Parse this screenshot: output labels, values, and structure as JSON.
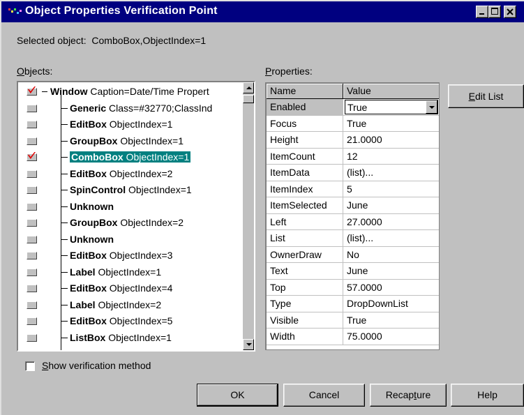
{
  "window": {
    "title": "Object Properties Verification Point",
    "selected_prefix": "Selected object:",
    "selected_value": "ComboBox,ObjectIndex=1"
  },
  "objects": {
    "label_accel": "O",
    "label_rest": "bjects:",
    "items": [
      {
        "name": "Window",
        "desc": "Caption=Date/Time Propert",
        "checked": true,
        "root": true
      },
      {
        "name": "Generic",
        "desc": "Class=#32770;ClassInd",
        "checked": false
      },
      {
        "name": "EditBox",
        "desc": "ObjectIndex=1",
        "checked": false
      },
      {
        "name": "GroupBox",
        "desc": "ObjectIndex=1",
        "checked": false
      },
      {
        "name": "ComboBox",
        "desc": "ObjectIndex=1",
        "checked": true,
        "selected": true
      },
      {
        "name": "EditBox",
        "desc": "ObjectIndex=2",
        "checked": false
      },
      {
        "name": "SpinControl",
        "desc": "ObjectIndex=1",
        "checked": false
      },
      {
        "name": "Unknown",
        "desc": "",
        "checked": false
      },
      {
        "name": "GroupBox",
        "desc": "ObjectIndex=2",
        "checked": false
      },
      {
        "name": "Unknown",
        "desc": "",
        "checked": false
      },
      {
        "name": "EditBox",
        "desc": "ObjectIndex=3",
        "checked": false
      },
      {
        "name": "Label",
        "desc": "ObjectIndex=1",
        "checked": false
      },
      {
        "name": "EditBox",
        "desc": "ObjectIndex=4",
        "checked": false
      },
      {
        "name": "Label",
        "desc": "ObjectIndex=2",
        "checked": false
      },
      {
        "name": "EditBox",
        "desc": "ObjectIndex=5",
        "checked": false
      },
      {
        "name": "ListBox",
        "desc": "ObjectIndex=1",
        "checked": false
      }
    ]
  },
  "properties": {
    "label_accel": "P",
    "label_rest": "roperties:",
    "col_name": "Name",
    "col_value": "Value",
    "rows": [
      {
        "name": "Enabled",
        "value": "True",
        "active": true
      },
      {
        "name": "Focus",
        "value": "True"
      },
      {
        "name": "Height",
        "value": "21.0000"
      },
      {
        "name": "ItemCount",
        "value": "12"
      },
      {
        "name": "ItemData",
        "value": "(list)..."
      },
      {
        "name": "ItemIndex",
        "value": "5"
      },
      {
        "name": "ItemSelected",
        "value": "June"
      },
      {
        "name": "Left",
        "value": "27.0000"
      },
      {
        "name": "List",
        "value": "(list)..."
      },
      {
        "name": "OwnerDraw",
        "value": "No"
      },
      {
        "name": "Text",
        "value": "June"
      },
      {
        "name": "Top",
        "value": "57.0000"
      },
      {
        "name": "Type",
        "value": "DropDownList"
      },
      {
        "name": "Visible",
        "value": "True"
      },
      {
        "name": "Width",
        "value": "75.0000"
      }
    ]
  },
  "buttons": {
    "edit_list_accel": "E",
    "edit_list_rest": "dit List",
    "ok": "OK",
    "cancel": "Cancel",
    "recapture_pre": "Recap",
    "recapture_accel": "t",
    "recapture_post": "ure",
    "help": "Help"
  },
  "show_method": {
    "accel": "S",
    "rest": "how verification method",
    "checked": false
  },
  "colors": {
    "titlebar": "#000080",
    "face": "#c0c0c0",
    "selection": "#008080",
    "check": "#e00000"
  }
}
